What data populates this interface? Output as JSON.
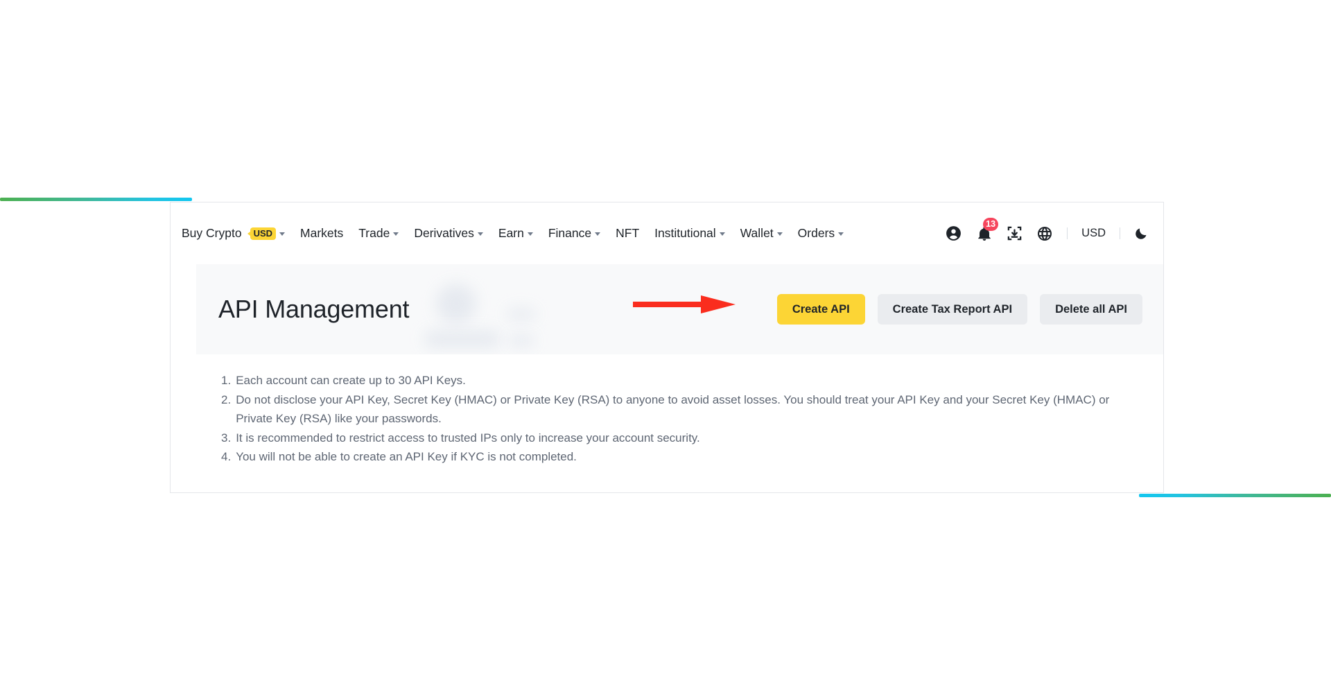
{
  "nav": {
    "left_items": [
      {
        "label": "Buy Crypto",
        "chip": "USD",
        "caret": true,
        "name": "nav-buy-crypto"
      },
      {
        "label": "Markets",
        "chip": null,
        "caret": false,
        "name": "nav-markets"
      },
      {
        "label": "Trade",
        "chip": null,
        "caret": true,
        "name": "nav-trade"
      },
      {
        "label": "Derivatives",
        "chip": null,
        "caret": true,
        "name": "nav-derivatives"
      },
      {
        "label": "Earn",
        "chip": null,
        "caret": true,
        "name": "nav-earn"
      },
      {
        "label": "Finance",
        "chip": null,
        "caret": true,
        "name": "nav-finance"
      },
      {
        "label": "NFT",
        "chip": null,
        "caret": false,
        "name": "nav-nft"
      },
      {
        "label": "Institutional",
        "chip": null,
        "caret": true,
        "name": "nav-institutional"
      },
      {
        "label": "Wallet",
        "chip": null,
        "caret": true,
        "name": "nav-wallet"
      },
      {
        "label": "Orders",
        "chip": null,
        "caret": true,
        "name": "nav-orders"
      }
    ],
    "icons": {
      "profile": "user-circle-icon",
      "notifications": "bell-icon",
      "notification_count": "13",
      "downloads": "download-box-icon",
      "language": "globe-icon",
      "theme": "moon-icon"
    },
    "currency": "USD"
  },
  "header": {
    "title": "API Management",
    "buttons": [
      {
        "label": "Create API",
        "style": "primary",
        "name": "create-api-button"
      },
      {
        "label": "Create Tax Report API",
        "style": "secondary",
        "name": "create-tax-report-api-button"
      },
      {
        "label": "Delete all API",
        "style": "secondary",
        "name": "delete-all-api-button"
      }
    ]
  },
  "notes": [
    {
      "num": "1.",
      "text": "Each account can create up to 30 API Keys."
    },
    {
      "num": "2.",
      "text": "Do not disclose your API Key, Secret Key (HMAC) or Private Key (RSA) to anyone to avoid asset losses. You should treat your API Key and your Secret Key (HMAC) or Private Key (RSA) like your passwords."
    },
    {
      "num": "3.",
      "text": "It is recommended to restrict access to trusted IPs only to increase your account security."
    },
    {
      "num": "4.",
      "text": "You will not be able to create an API Key if KYC is not completed."
    }
  ],
  "annotation": {
    "arrow_color": "#fa2d1e",
    "points_to": "create-api-button"
  },
  "colors": {
    "accent_yellow": "#fcd535",
    "secondary_gray": "#eaecef",
    "text_primary": "#1e2329",
    "text_muted": "#5e6673",
    "badge_red": "#f6465d",
    "band_bg": "#f8f9fa"
  }
}
